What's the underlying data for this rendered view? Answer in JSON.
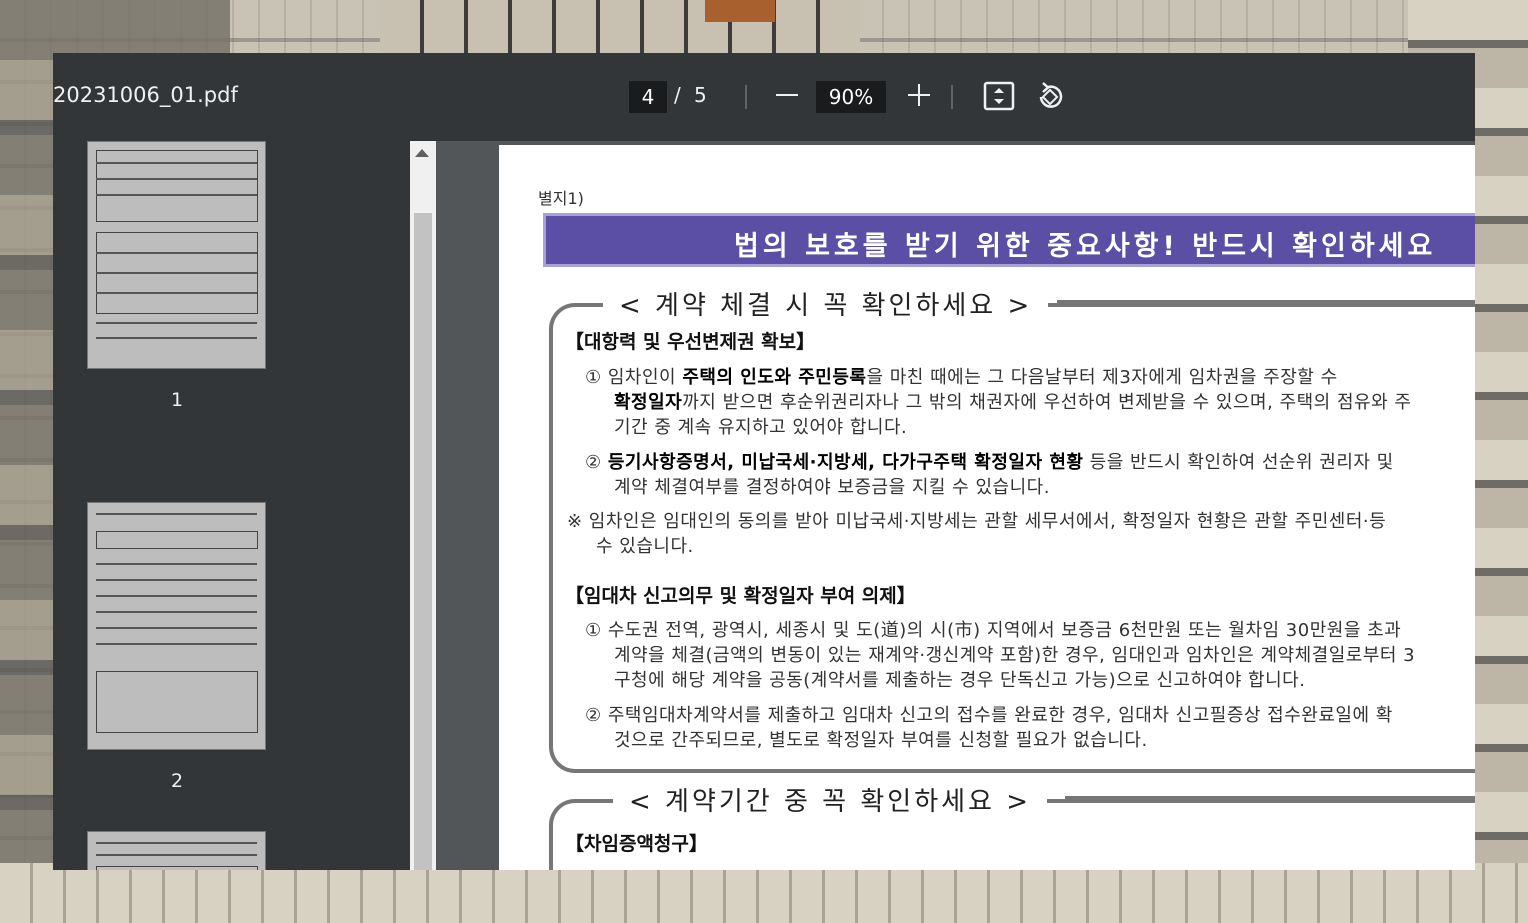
{
  "viewer": {
    "filename": "20231006_01.pdf",
    "current_page": "4",
    "page_separator": "/",
    "total_pages": "5",
    "zoom": "90%"
  },
  "thumbnails": [
    {
      "label": "1"
    },
    {
      "label": "2"
    }
  ],
  "document": {
    "appendix_label": "별지1)",
    "banner": "법의 보호를 받기 위한 중요사항! 반드시 확인하세요",
    "section1": {
      "title": "< 계약 체결 시 꼭 확인하세요 >",
      "h1": "【대항력 및 우선변제권 확보】",
      "item1_l1_a": "① 임차인이 ",
      "item1_l1_b": "주택의 인도와 주민등록",
      "item1_l1_c": "을 마친 때에는 그 다음날부터 제3자에게 임차권을 주장할 수",
      "item1_l2_a": "확정일자",
      "item1_l2_b": "까지 받으면 후순위권리자나 그 밖의 채권자에 우선하여 변제받을 수 있으며, 주택의 점유와 주",
      "item1_l3": "기간 중 계속 유지하고 있어야 합니다.",
      "item2_l1_a": "② ",
      "item2_l1_b": "등기사항증명서, 미납국세·지방세, 다가구주택 확정일자 현황",
      "item2_l1_c": " 등을 반드시 확인하여 선순위 권리자 및",
      "item2_l2": "계약 체결여부를 결정하여야 보증금을 지킬 수 있습니다.",
      "note_l1": "※ 임차인은 임대인의 동의를 받아 미납국세·지방세는 관할 세무서에서, 확정일자 현황은 관할 주민센터·등",
      "note_l2": "수 있습니다.",
      "h2": "【임대차 신고의무 및 확정일자 부여 의제】",
      "item3_l1": "① 수도권 전역, 광역시, 세종시 및 도(道)의 시(市) 지역에서 보증금 6천만원 또는 월차임 30만원을 초과",
      "item3_l2": "계약을 체결(금액의 변동이 있는 재계약·갱신계약 포함)한 경우, 임대인과 임차인은 계약체결일로부터 3",
      "item3_l3": "구청에 해당 계약을 공동(계약서를 제출하는 경우 단독신고 가능)으로 신고하여야 합니다.",
      "item4_l1": "② 주택임대차계약서를 제출하고 임대차 신고의 접수를 완료한 경우, 임대차 신고필증상 접수완료일에 확",
      "item4_l2": "것으로 간주되므로, 별도로 확정일자 부여를 신청할 필요가 없습니다."
    },
    "section2": {
      "title": "< 계약기간 중 꼭 확인하세요 >",
      "h1": "【차임증액청구】"
    }
  },
  "colors": {
    "toolbar": "#323639",
    "banner": "#5a4fa5"
  }
}
